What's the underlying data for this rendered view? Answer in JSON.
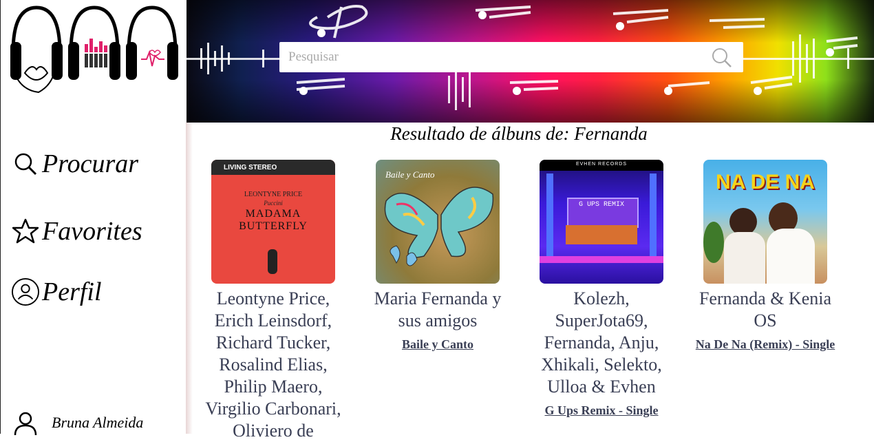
{
  "search": {
    "placeholder": "Pesquisar"
  },
  "nav": [
    {
      "label": "Procurar",
      "icon": "search-icon"
    },
    {
      "label": "Favorites",
      "icon": "star-icon"
    },
    {
      "label": "Perfil",
      "icon": "user-circle-icon"
    }
  ],
  "user": {
    "name": "Bruna Almeida",
    "icon": "user-icon"
  },
  "results": {
    "title": "Resultado de álbuns de: Fernanda",
    "albums": [
      {
        "artist": "Leontyne Price, Erich Leinsdorf, Richard Tucker, Rosalind Elias, Philip Maero, Virgilio Carbonari, Oliviero de",
        "album": "",
        "cover_text": {
          "top": "LIVING STEREO",
          "artist": "LEONTYNE PRICE",
          "sub": "Puccini",
          "title1": "MADAMA",
          "title2": "BUTTERFLY"
        }
      },
      {
        "artist": "Maria Fernanda y sus amigos",
        "album": "Baile y Canto",
        "cover_text": {
          "title": "Baile y Canto"
        }
      },
      {
        "artist": "Kolezh, SuperJota69, Fernanda, Anju, Xhikali, Selekto, Ulloa & Evhen",
        "album": "G Ups Remix - Single",
        "cover_text": {
          "label": "EVHEN RECORDS",
          "title": "G UPS REMIX"
        }
      },
      {
        "artist": "Fernanda & Kenia OS",
        "album": "Na De Na (Remix) - Single",
        "cover_text": {
          "title": "NA DE NA"
        }
      }
    ]
  },
  "colors": {
    "text_dark": "#3a3f55",
    "cover1_bg": "#e9483f"
  }
}
